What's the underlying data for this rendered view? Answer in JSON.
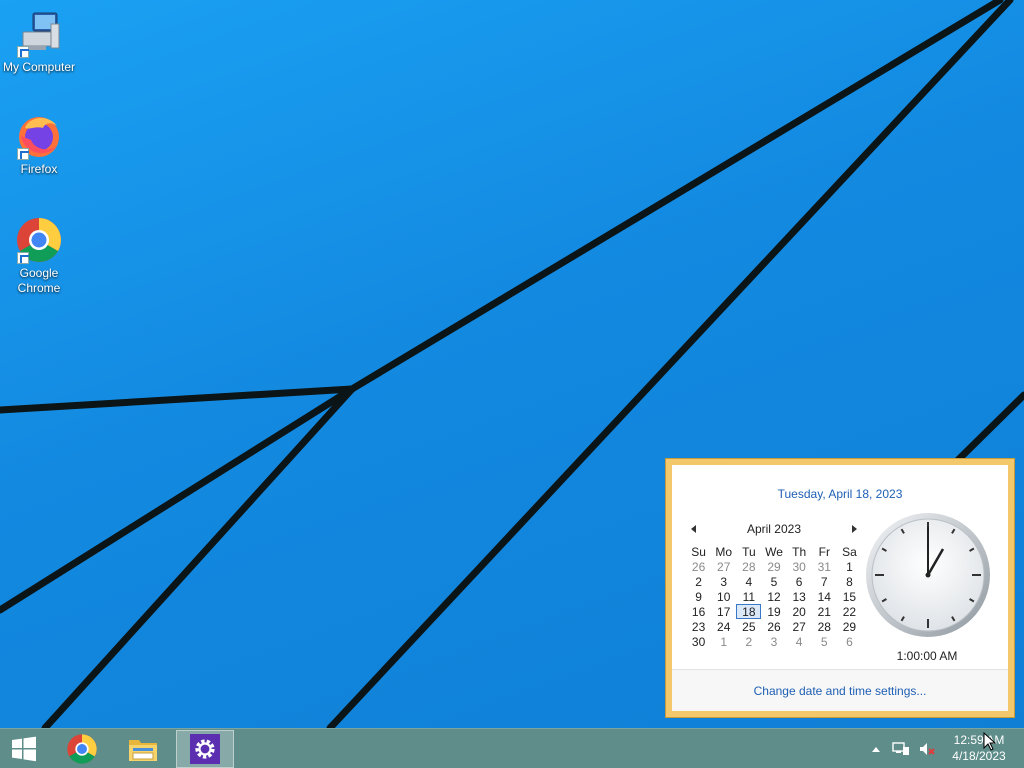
{
  "desktop": {
    "icons": [
      {
        "label": "My Computer"
      },
      {
        "label": "Firefox"
      },
      {
        "label": "Google Chrome"
      }
    ]
  },
  "taskbar": {
    "pinned": [
      "chrome-icon",
      "file-explorer-icon",
      "settings-icon"
    ],
    "time": "12:59 AM",
    "date": "4/18/2023"
  },
  "flyout": {
    "date_header": "Tuesday, April 18, 2023",
    "month_label": "April 2023",
    "weekdays": [
      "Su",
      "Mo",
      "Tu",
      "We",
      "Th",
      "Fr",
      "Sa"
    ],
    "weeks": [
      [
        "26",
        "27",
        "28",
        "29",
        "30",
        "31",
        "1"
      ],
      [
        "2",
        "3",
        "4",
        "5",
        "6",
        "7",
        "8"
      ],
      [
        "9",
        "10",
        "11",
        "12",
        "13",
        "14",
        "15"
      ],
      [
        "16",
        "17",
        "18",
        "19",
        "20",
        "21",
        "22"
      ],
      [
        "23",
        "24",
        "25",
        "26",
        "27",
        "28",
        "29"
      ],
      [
        "30",
        "1",
        "2",
        "3",
        "4",
        "5",
        "6"
      ]
    ],
    "today": "18",
    "clock_time": "1:00:00 AM",
    "settings_link": "Change date and time settings..."
  },
  "colors": {
    "accent_link": "#1e5fb4",
    "flyout_border": "#f2c86a",
    "taskbar": "#5f8d8a"
  }
}
